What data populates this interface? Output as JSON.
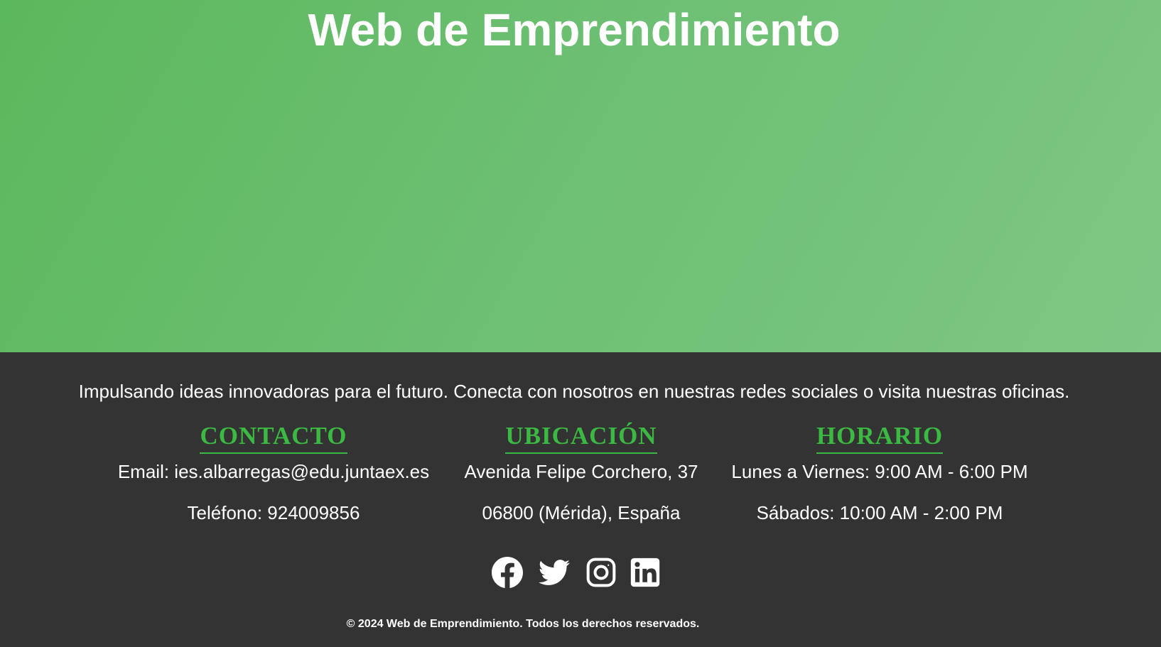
{
  "hero": {
    "title": "Web de Emprendimiento"
  },
  "footer": {
    "tagline": "Impulsando ideas innovadoras para el futuro. Conecta con nosotros en nuestras redes sociales o visita nuestras oficinas.",
    "columns": [
      {
        "heading": "CONTACTO",
        "lines": [
          "Email: ies.albarregas@edu.juntaex.es",
          "Teléfono: 924009856"
        ]
      },
      {
        "heading": "UBICACIÓN",
        "lines": [
          "Avenida Felipe Corchero, 37",
          "06800 (Mérida), España"
        ]
      },
      {
        "heading": "HORARIO",
        "lines": [
          "Lunes a Viernes: 9:00 AM - 6:00 PM",
          "Sábados: 10:00 AM - 2:00 PM"
        ]
      }
    ],
    "social_icons": [
      "facebook-icon",
      "twitter-icon",
      "instagram-icon",
      "linkedin-icon"
    ],
    "copyright": "© 2024 Web de Emprendimiento. Todos los derechos reservados."
  },
  "colors": {
    "hero_gradient_start": "#5cb85c",
    "hero_gradient_end": "#7ec784",
    "footer_background": "#333333",
    "heading_accent": "#3cb943",
    "text": "#ffffff"
  }
}
